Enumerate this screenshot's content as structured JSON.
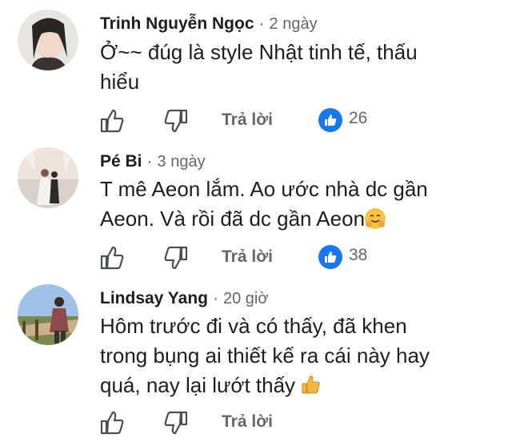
{
  "comments": [
    {
      "author": "Trinh Nguyễn Ngọc",
      "time": "2 ngày",
      "lines": [
        "Ở~~ đúg là style Nhật tinh tế, thấu",
        "hiểu"
      ],
      "reply_label": "Trả lời",
      "likes": "26",
      "avatar_icon": "avatar-photo"
    },
    {
      "author": "Pé Bi",
      "time": "3 ngày",
      "lines": [
        "T mê Aeon lắm. Ao ước nhà dc gần",
        "Aeon. Và rồi đã dc gần Aeon"
      ],
      "reply_label": "Trả lời",
      "likes": "38",
      "trailing_emoji": "hugging-face-emoji",
      "avatar_icon": "avatar-photo"
    },
    {
      "author": "Lindsay Yang",
      "time": "20 giờ",
      "lines": [
        "Hôm trước đi và có thấy, đã khen",
        "trong bụng ai thiết kế ra cái này hay",
        "quá, nay lại lướt thấy"
      ],
      "reply_label": "Trả lời",
      "trailing_emoji": "thumbs-up-emoji",
      "avatar_icon": "avatar-photo"
    }
  ],
  "separator": "·",
  "colors": {
    "like_blue": "#1877f2",
    "meta_gray": "#65676b",
    "text": "#1c1e21"
  }
}
